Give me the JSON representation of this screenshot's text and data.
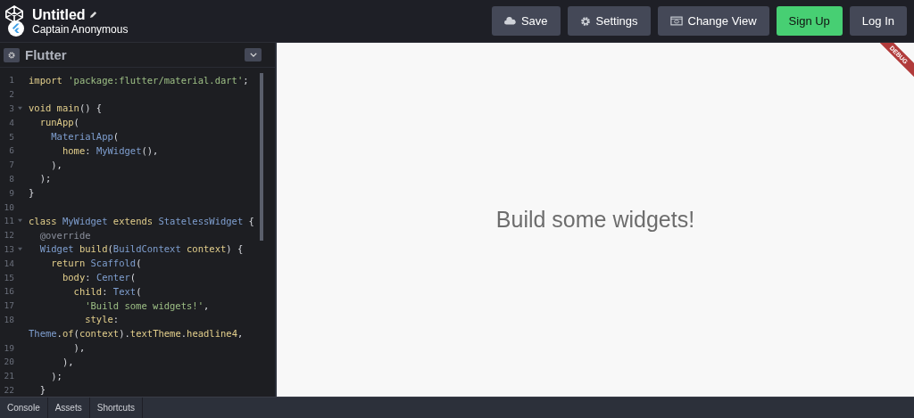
{
  "header": {
    "title": "Untitled",
    "author": "Captain Anonymous"
  },
  "buttons": [
    {
      "label": "Save",
      "kind": "plain"
    },
    {
      "label": "Settings",
      "kind": "plain"
    },
    {
      "label": "Change View",
      "kind": "plain"
    },
    {
      "label": "Sign Up",
      "kind": "primary"
    },
    {
      "label": "Log In",
      "kind": "plain"
    }
  ],
  "editor": {
    "title": "Flutter",
    "lines": [
      {
        "number": "1",
        "fold": false,
        "tokens": [
          {
            "text": "import ",
            "kind": "kw"
          },
          {
            "text": "'package:flutter/material.dart'",
            "kind": "str"
          },
          {
            "text": ";",
            "kind": "plain"
          }
        ]
      },
      {
        "number": "2",
        "fold": false
      },
      {
        "number": "3",
        "fold": true,
        "tokens": [
          {
            "text": "void ",
            "kind": "kw"
          },
          {
            "text": "main",
            "kind": "kw"
          },
          {
            "text": "() {",
            "kind": "plain"
          }
        ]
      },
      {
        "number": "4",
        "fold": false,
        "tokens": [
          {
            "text": "  runApp",
            "kind": "kw"
          },
          {
            "text": "(",
            "kind": "plain"
          }
        ]
      },
      {
        "number": "5",
        "fold": false,
        "tokens": [
          {
            "text": "    MaterialApp",
            "kind": "type"
          },
          {
            "text": "(",
            "kind": "plain"
          }
        ]
      },
      {
        "number": "6",
        "fold": false,
        "tokens": [
          {
            "text": "      home",
            "kind": "kw"
          },
          {
            "text": ": ",
            "kind": "plain"
          },
          {
            "text": "MyWidget",
            "kind": "type"
          },
          {
            "text": "(),",
            "kind": "plain"
          }
        ]
      },
      {
        "number": "7",
        "fold": false,
        "tokens": [
          {
            "text": "    ),",
            "kind": "plain"
          }
        ]
      },
      {
        "number": "8",
        "fold": false,
        "tokens": [
          {
            "text": "  );",
            "kind": "plain"
          }
        ]
      },
      {
        "number": "9",
        "fold": false,
        "tokens": [
          {
            "text": "}",
            "kind": "plain"
          }
        ]
      },
      {
        "number": "10",
        "fold": false
      },
      {
        "number": "11",
        "fold": true,
        "tokens": [
          {
            "text": "class ",
            "kind": "kw"
          },
          {
            "text": "MyWidget ",
            "kind": "type"
          },
          {
            "text": "extends ",
            "kind": "kw"
          },
          {
            "text": "StatelessWidget",
            "kind": "type"
          },
          {
            "text": " {",
            "kind": "plain"
          }
        ]
      },
      {
        "number": "12",
        "fold": false,
        "tokens": [
          {
            "text": "  @override",
            "kind": "meta"
          }
        ]
      },
      {
        "number": "13",
        "fold": true,
        "tokens": [
          {
            "text": "  Widget ",
            "kind": "type"
          },
          {
            "text": "build",
            "kind": "kw"
          },
          {
            "text": "(",
            "kind": "plain"
          },
          {
            "text": "BuildContext ",
            "kind": "type"
          },
          {
            "text": "context",
            "kind": "kw"
          },
          {
            "text": ") {",
            "kind": "plain"
          }
        ]
      },
      {
        "number": "14",
        "fold": false,
        "tokens": [
          {
            "text": "    return ",
            "kind": "kw"
          },
          {
            "text": "Scaffold",
            "kind": "type"
          },
          {
            "text": "(",
            "kind": "plain"
          }
        ]
      },
      {
        "number": "15",
        "fold": false,
        "tokens": [
          {
            "text": "      body",
            "kind": "kw"
          },
          {
            "text": ": ",
            "kind": "plain"
          },
          {
            "text": "Center",
            "kind": "type"
          },
          {
            "text": "(",
            "kind": "plain"
          }
        ]
      },
      {
        "number": "16",
        "fold": false,
        "tokens": [
          {
            "text": "        child",
            "kind": "kw"
          },
          {
            "text": ": ",
            "kind": "plain"
          },
          {
            "text": "Text",
            "kind": "type"
          },
          {
            "text": "(",
            "kind": "plain"
          }
        ]
      },
      {
        "number": "17",
        "fold": false,
        "tokens": [
          {
            "text": "          'Build some widgets!'",
            "kind": "str"
          },
          {
            "text": ",",
            "kind": "plain"
          }
        ]
      },
      {
        "number": "18",
        "fold": false,
        "tokens": [
          {
            "text": "          style",
            "kind": "kw"
          },
          {
            "text": ":",
            "kind": "plain"
          }
        ]
      },
      {
        "fold": false,
        "tokens": [
          {
            "text": "Theme",
            "kind": "type"
          },
          {
            "text": ".",
            "kind": "plain"
          },
          {
            "text": "of",
            "kind": "kw"
          },
          {
            "text": "(",
            "kind": "plain"
          },
          {
            "text": "context",
            "kind": "kw"
          },
          {
            "text": ").",
            "kind": "plain"
          },
          {
            "text": "textTheme",
            "kind": "kw"
          },
          {
            "text": ".",
            "kind": "plain"
          },
          {
            "text": "headline4",
            "kind": "kw"
          },
          {
            "text": ",",
            "kind": "plain"
          }
        ]
      },
      {
        "number": "19",
        "fold": false,
        "tokens": [
          {
            "text": "        ),",
            "kind": "plain"
          }
        ]
      },
      {
        "number": "20",
        "fold": false,
        "tokens": [
          {
            "text": "      ),",
            "kind": "plain"
          }
        ]
      },
      {
        "number": "21",
        "fold": false,
        "tokens": [
          {
            "text": "    );",
            "kind": "plain"
          }
        ]
      },
      {
        "number": "22",
        "fold": false,
        "tokens": [
          {
            "text": "  }",
            "kind": "plain"
          }
        ]
      }
    ]
  },
  "preview": {
    "text": "Build some widgets!",
    "ribbon": "DEBUG"
  },
  "footer_tabs": [
    "Console",
    "Assets",
    "Shortcuts"
  ]
}
